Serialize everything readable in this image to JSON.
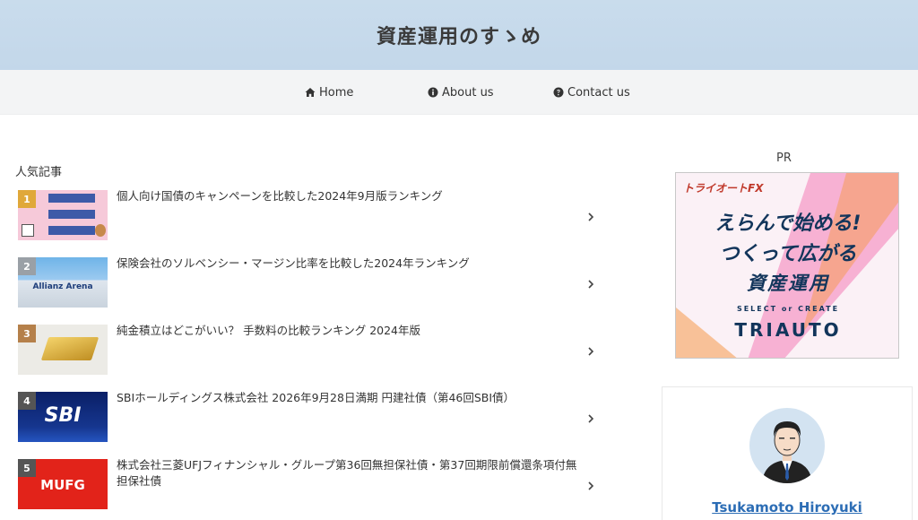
{
  "site": {
    "title": "資産運用のすゝめ"
  },
  "nav": [
    {
      "label": "Home",
      "icon": "home-icon"
    },
    {
      "label": "About us",
      "icon": "info-icon"
    },
    {
      "label": "Contact us",
      "icon": "question-icon"
    }
  ],
  "popular": {
    "heading": "人気記事",
    "items": [
      {
        "rank": "1",
        "title": "個人向け国債のキャンペーンを比較した2024年9月版ランキング",
        "badge_color": "#e0a83a"
      },
      {
        "rank": "2",
        "title": "保険会社のソルベンシー・マージン比率を比較した2024年ランキング",
        "badge_color": "#9aa0a6",
        "thumb_text": "Allianz Arena"
      },
      {
        "rank": "3",
        "title": "純金積立はどこがいい？ 手数料の比較ランキング 2024年版",
        "badge_color": "#b5804a"
      },
      {
        "rank": "4",
        "title": "SBIホールディングス株式会社 2026年9月28日満期 円建社債（第46回SBI債）",
        "badge_color": "#555555",
        "thumb_text": "SBI"
      },
      {
        "rank": "5",
        "title": "株式会社三菱UFJフィナンシャル・グループ第36回無担保社債・第37回期限前償還条項付無担保社債",
        "badge_color": "#555555",
        "thumb_text": "MUFG"
      }
    ]
  },
  "sidebar": {
    "pr_label": "PR",
    "ad": {
      "brand": "トライオートFX",
      "line1": "えらんで始める!",
      "line2": "つくって広がる",
      "line3": "資産運用",
      "sub": "SELECT or CREATE",
      "logo": "TRIAUTO"
    },
    "profile": {
      "name": "Tsukamoto Hiroyuki"
    }
  }
}
